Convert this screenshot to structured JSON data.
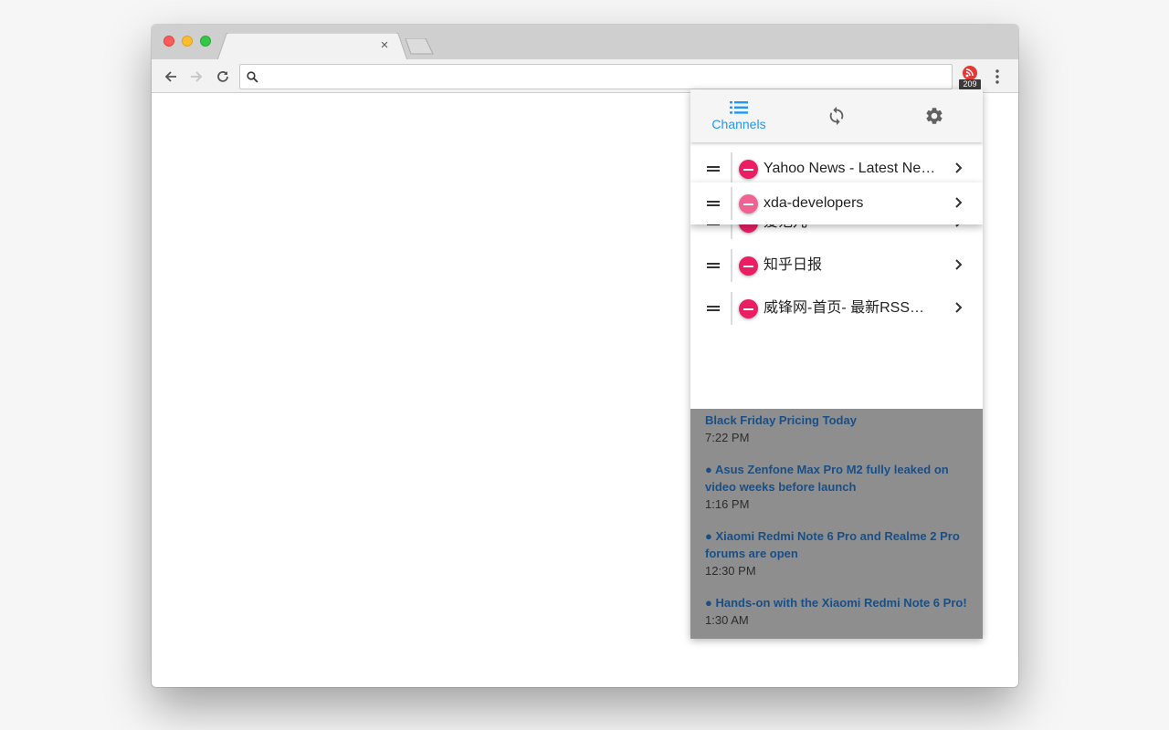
{
  "browser": {
    "tab_close": "×",
    "address_placeholder": "",
    "extension_badge": "209"
  },
  "popup": {
    "tabs": [
      {
        "label": "Channels",
        "icon": "list-icon",
        "active": true
      },
      {
        "label": "",
        "icon": "sync-icon"
      },
      {
        "label": "",
        "icon": "gear-icon"
      }
    ],
    "channels": [
      {
        "name": "Yahoo News - Latest News & Headlines"
      },
      {
        "name": "xda-developers"
      },
      {
        "name": "爱范儿"
      },
      {
        "name": "知乎日报"
      },
      {
        "name": "威锋网-首页- 最新RSS订阅"
      }
    ],
    "footer": {
      "add": "+",
      "edit_icon": "pencil-icon"
    },
    "news": [
      {
        "title": "Black Friday Pricing Today",
        "time": "7:22 PM"
      },
      {
        "title": "● Asus Zenfone Max Pro M2 fully leaked on video weeks before launch",
        "time": "1:16 PM"
      },
      {
        "title": "● Xiaomi Redmi Note 6 Pro and Realme 2 Pro forums are open",
        "time": "12:30 PM"
      },
      {
        "title": "● Hands-on with the Xiaomi Redmi Note 6 Pro!",
        "time": "1:30 AM"
      }
    ]
  },
  "colors": {
    "accent": "#2196f3",
    "remove": "#e91e63",
    "news_link": "#1a4f86"
  }
}
